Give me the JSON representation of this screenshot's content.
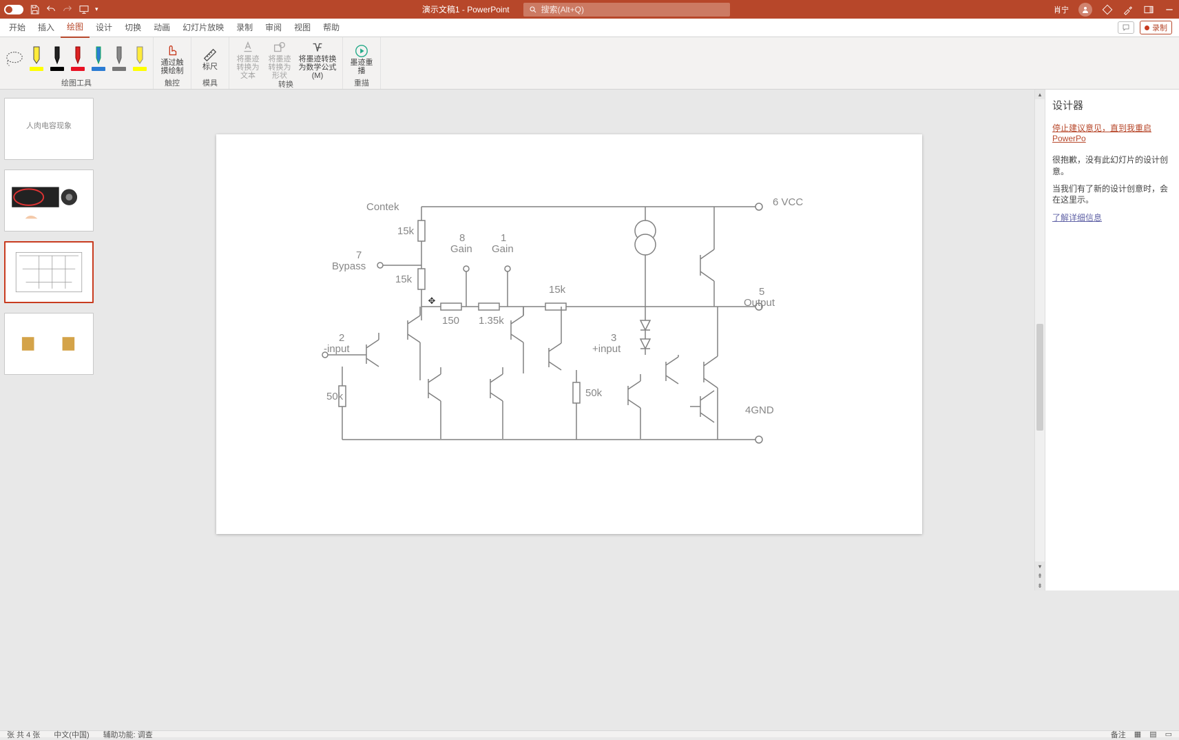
{
  "titlebar": {
    "doc_title": "演示文稿1 - PowerPoint",
    "search_placeholder": "搜索(Alt+Q)",
    "user": "肖宁"
  },
  "tabs": {
    "items": [
      "开始",
      "插入",
      "绘图",
      "设计",
      "切换",
      "动画",
      "幻灯片放映",
      "录制",
      "审阅",
      "视图",
      "帮助"
    ],
    "active_index": 2,
    "record_label": "录制"
  },
  "ribbon": {
    "g_tools": "绘图工具",
    "g_touch": "触控",
    "g_stencil": "模具",
    "g_convert": "转换",
    "g_replay": "重描",
    "touch_btn": "通过触摸绘制",
    "ruler_btn": "标尺",
    "conv_text": "将墨迹转换为文本",
    "conv_shape": "将墨迹转换为形状",
    "conv_math": "将墨迹转换为数学公式(M)",
    "replay_btn": "墨迹重播",
    "pen_colors": [
      "#ffff00",
      "#000000",
      "#e81123",
      "#2b7cd3",
      "#777777",
      "#ffff00"
    ]
  },
  "thumbs": {
    "items": [
      {
        "text": "人肉电容现象"
      },
      {
        "text": ""
      },
      {
        "text": ""
      },
      {
        "text": ""
      }
    ],
    "selected": 2
  },
  "designer": {
    "title": "设计器",
    "stop_link": "停止建议意见，直到我重启 PowerPo",
    "sorry": "很抱歉，没有此幻灯片的设计创意。",
    "when": "当我们有了新的设计创意时，会在这里示。",
    "more": "了解详细信息"
  },
  "statusbar": {
    "slides": "张    共 4 张",
    "lang": "中文(中国)",
    "access": "辅助功能: 调查",
    "notes": "备注"
  },
  "circuit": {
    "title": "Contek",
    "pin2": "2\n-input",
    "pin3": "3\n+input",
    "pin4": "4GND",
    "pin5": "5\nOutput",
    "pin6": "6\nVCC",
    "pin7": "7\nBypass",
    "pin8": "8\nGain",
    "pin1": "1\nGain",
    "r15ka": "15k",
    "r15kb": "15k",
    "r15kc": "15k",
    "r150": "150",
    "r135k": "1.35k",
    "r50ka": "50k",
    "r50kb": "50k"
  }
}
